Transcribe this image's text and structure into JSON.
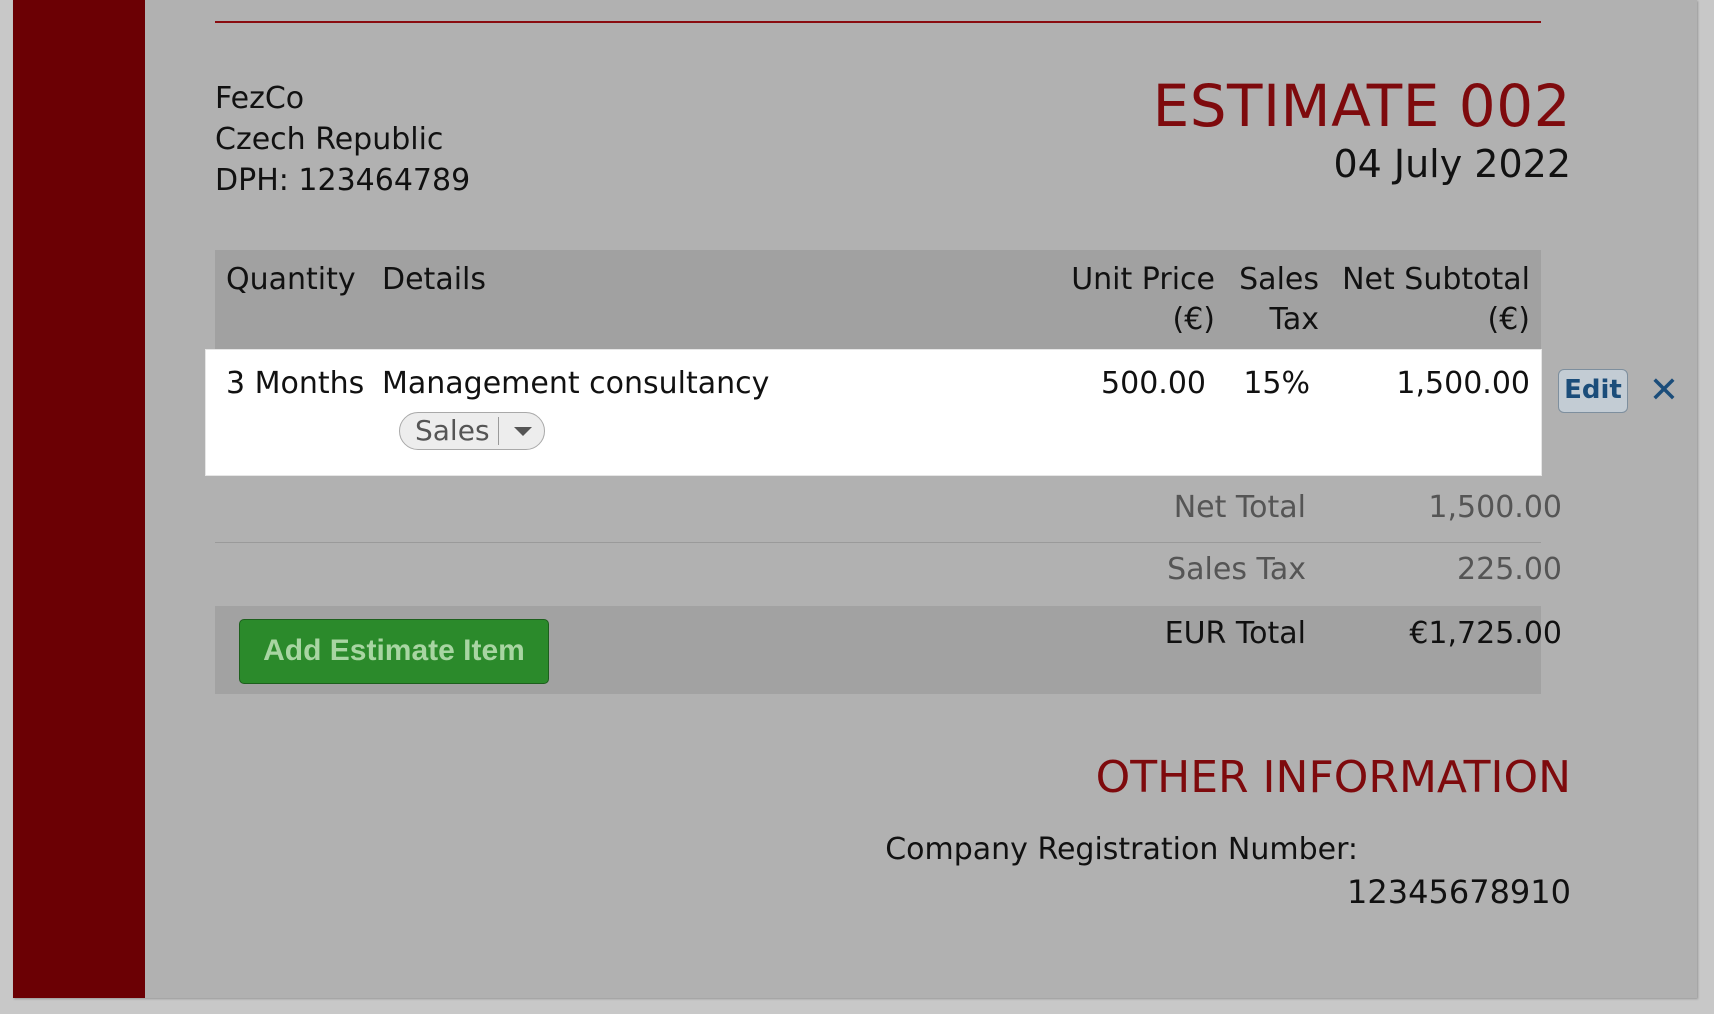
{
  "company": {
    "name": "FezCo",
    "country": "Czech Republic",
    "tax_id": "DPH: 123464789"
  },
  "estimate": {
    "title": "ESTIMATE 002",
    "date": "04 July 2022"
  },
  "table": {
    "headers": {
      "quantity": "Quantity",
      "details": "Details",
      "unit_price_line1": "Unit Price",
      "unit_price_line2": "(€)",
      "sales_tax_line1": "Sales",
      "sales_tax_line2": "Tax",
      "net_subtotal_line1": "Net Subtotal",
      "net_subtotal_line2": "(€)"
    },
    "rows": [
      {
        "quantity": "3 Months",
        "details": "Management consultancy",
        "category": "Sales",
        "unit_price": "500.00",
        "sales_tax": "15%",
        "net_subtotal": "1,500.00",
        "edit_label": "Edit",
        "delete_label": "✕"
      }
    ]
  },
  "summary": {
    "net_total_label": "Net Total",
    "net_total_value": "1,500.00",
    "sales_tax_label": "Sales Tax",
    "sales_tax_value": "225.00",
    "eur_total_label": "EUR Total",
    "eur_total_value": "€1,725.00"
  },
  "actions": {
    "add_item_label": "Add Estimate Item"
  },
  "other_info": {
    "title": "OTHER INFORMATION",
    "reg_label": "Company Registration Number:",
    "reg_value": "12345678910"
  },
  "colors": {
    "brand_red": "#7e0a0d",
    "spine": "#6b0004",
    "button_green": "#2b8a2b",
    "link_blue": "#1b4d7a"
  }
}
